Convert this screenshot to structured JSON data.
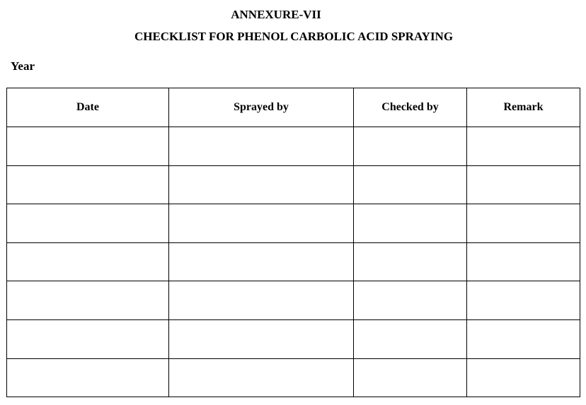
{
  "document": {
    "annexure": "ANNEXURE-VII",
    "title": "CHECKLIST FOR PHENOL CARBOLIC ACID SPRAYING",
    "year_label": "Year"
  },
  "table": {
    "columns": [
      "Date",
      "Sprayed by",
      "Checked by",
      "Remark"
    ],
    "rows": [
      [
        "",
        "",
        "",
        ""
      ],
      [
        "",
        "",
        "",
        ""
      ],
      [
        "",
        "",
        "",
        ""
      ],
      [
        "",
        "",
        "",
        ""
      ],
      [
        "",
        "",
        "",
        ""
      ],
      [
        "",
        "",
        "",
        ""
      ],
      [
        "",
        "",
        "",
        ""
      ]
    ]
  }
}
